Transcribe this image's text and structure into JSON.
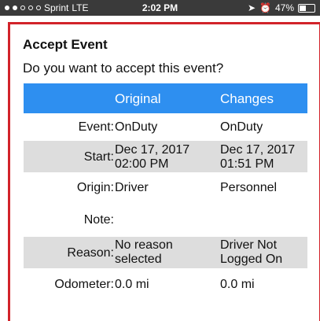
{
  "status_bar": {
    "carrier": "Sprint",
    "network": "LTE",
    "time": "2:02 PM",
    "battery": "47%",
    "battery_level": 0.47
  },
  "dialog": {
    "title": "Accept Event",
    "question": "Do you want to accept this event?",
    "columns": {
      "original": "Original",
      "changes": "Changes"
    },
    "rows": [
      {
        "label": "Event:",
        "original": "OnDuty",
        "changes": "OnDuty"
      },
      {
        "label": "Start:",
        "original": "Dec 17, 2017\n02:00 PM",
        "changes": "Dec 17, 2017\n01:51 PM"
      },
      {
        "label": "Origin:",
        "original": "Driver",
        "changes": "Personnel"
      },
      {
        "label": "Note:",
        "original": "",
        "changes": ""
      },
      {
        "label": "Reason:",
        "original": "No reason\nselected",
        "changes": "Driver Not\nLogged On"
      },
      {
        "label": "Odometer:",
        "original": "0.0 mi",
        "changes": "0.0 mi"
      }
    ]
  },
  "colors": {
    "header": "#2e8ff0",
    "border": "#d2232a",
    "row_shade": "#dddddd"
  }
}
